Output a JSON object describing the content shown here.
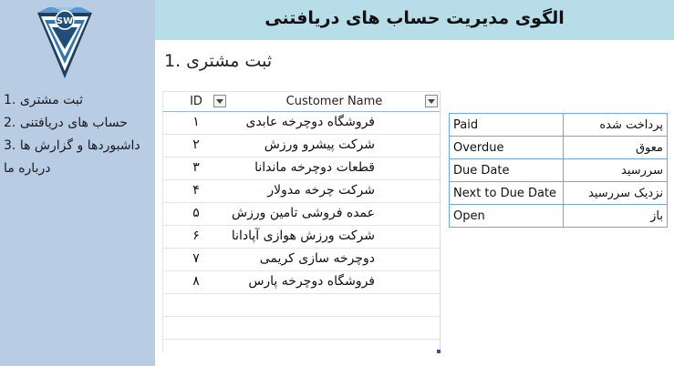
{
  "header": {
    "title": "الگوی مدیریت حساب های دریافتنی"
  },
  "logo": {
    "text": "SW"
  },
  "sidebar": {
    "items": [
      {
        "label": "ثبت مشتری .1"
      },
      {
        "label": "حساب های دریافتنی .2"
      },
      {
        "label": "داشبوردها و گزارش ها .3"
      },
      {
        "label": "درباره ما"
      }
    ]
  },
  "section": {
    "title": "ثبت مشتری .1"
  },
  "table": {
    "columns": {
      "id": "ID",
      "name": "Customer Name"
    },
    "rows": [
      {
        "id": "۱",
        "name": "فروشگاه دوچرخه عابدی"
      },
      {
        "id": "۲",
        "name": "شرکت پیشرو ورزش"
      },
      {
        "id": "۳",
        "name": "قطعات دوچرخه ماندانا"
      },
      {
        "id": "۴",
        "name": "شرکت چرخه مدولار"
      },
      {
        "id": "۵",
        "name": "عمده فروشی تامین ورزش"
      },
      {
        "id": "۶",
        "name": "شرکت ورزش هوازی آپادانا"
      },
      {
        "id": "۷",
        "name": "دوچرخه سازی کریمی"
      },
      {
        "id": "۸",
        "name": "فروشگاه دوچرخه پارس"
      }
    ]
  },
  "legend": [
    {
      "en": "Paid",
      "fa": "پرداخت شده"
    },
    {
      "en": "Overdue",
      "fa": "معوق"
    },
    {
      "en": "Due Date",
      "fa": "سررسید"
    },
    {
      "en": "Next to Due Date",
      "fa": "نزدیک سررسید"
    },
    {
      "en": "Open",
      "fa": "باز"
    }
  ],
  "colors": {
    "sidebar": "#b8cce4",
    "header": "#b7dee8",
    "grid": "#6fa8dc",
    "logo_blue": "#1f4e79"
  }
}
